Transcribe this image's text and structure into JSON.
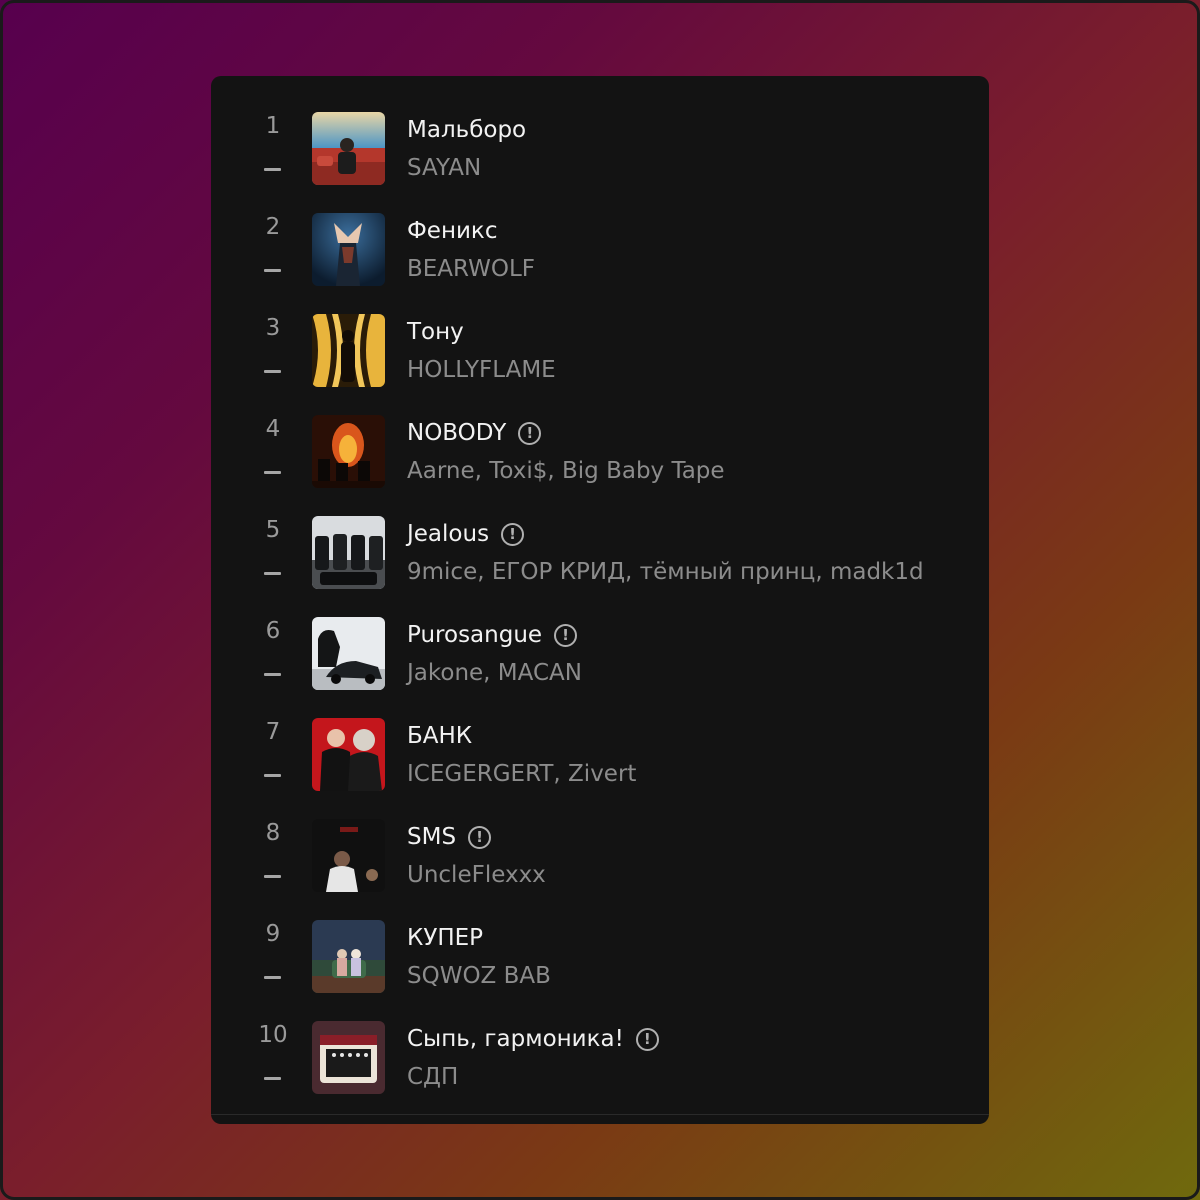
{
  "chart": {
    "tracks": [
      {
        "rank": "1",
        "change": "–",
        "title": "Мальборо",
        "artists": "SAYAN",
        "explicit": false,
        "cover_icon": "album-cover"
      },
      {
        "rank": "2",
        "change": "–",
        "title": "Феникс",
        "artists": "BEARWOLF",
        "explicit": false,
        "cover_icon": "album-cover"
      },
      {
        "rank": "3",
        "change": "–",
        "title": "Тону",
        "artists": "HOLLYFLAME",
        "explicit": false,
        "cover_icon": "album-cover"
      },
      {
        "rank": "4",
        "change": "–",
        "title": "NOBODY",
        "artists": "Aarne, Toxi$, Big Baby Tape",
        "explicit": true,
        "cover_icon": "album-cover"
      },
      {
        "rank": "5",
        "change": "–",
        "title": "Jealous",
        "artists": "9mice, ЕГОР КРИД, тёмный принц, madk1d",
        "explicit": true,
        "cover_icon": "album-cover"
      },
      {
        "rank": "6",
        "change": "–",
        "title": "Purosangue",
        "artists": "Jakone, MACAN",
        "explicit": true,
        "cover_icon": "album-cover"
      },
      {
        "rank": "7",
        "change": "–",
        "title": "БАНК",
        "artists": "ICEGERGERT, Zivert",
        "explicit": false,
        "cover_icon": "album-cover"
      },
      {
        "rank": "8",
        "change": "–",
        "title": "SMS",
        "artists": "UncleFlexxx",
        "explicit": true,
        "cover_icon": "album-cover"
      },
      {
        "rank": "9",
        "change": "–",
        "title": "КУПЕР",
        "artists": "SQWOZ BAB",
        "explicit": false,
        "cover_icon": "album-cover"
      },
      {
        "rank": "10",
        "change": "–",
        "title": "Сыпь, гармоника!",
        "artists": "СДП",
        "explicit": true,
        "cover_icon": "album-cover"
      }
    ],
    "explicit_glyph": "!",
    "colors": {
      "panel": "#131313",
      "title": "#f2f2f2",
      "artist": "#8c8c8c",
      "rank": "#9a9a9a"
    }
  }
}
